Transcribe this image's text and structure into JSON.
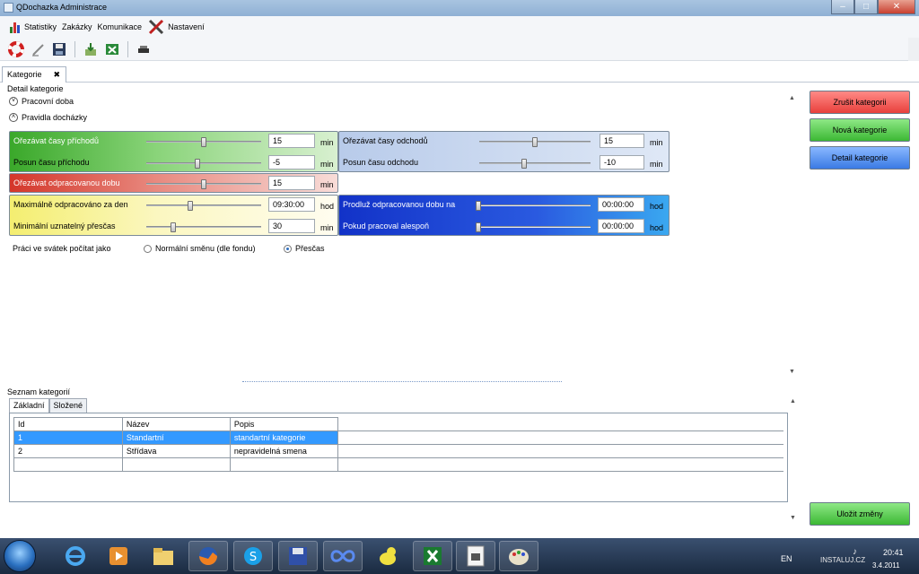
{
  "window": {
    "title": "QDochazka Administrace",
    "btn_min": "–",
    "btn_max": "□",
    "btn_close": "✕"
  },
  "menu": {
    "items": [
      {
        "label": "Statistiky",
        "icon": "bar-chart-icon"
      },
      {
        "label": "Zakázky"
      },
      {
        "label": "Komunikace"
      },
      {
        "label": "Nastavení",
        "icon": "tools-icon"
      }
    ]
  },
  "toolbar": {
    "icons": [
      "lifebuoy-icon",
      "edit-icon",
      "save-icon",
      "import-icon",
      "excel-export-icon",
      "print-icon"
    ]
  },
  "doc_tab": {
    "label": "Kategorie",
    "close": "✖"
  },
  "detail": {
    "group_title": "Detail kategorie",
    "expanders": [
      {
        "label": "Pracovní doba",
        "glyph": "˅"
      },
      {
        "label": "Pravidla docházky",
        "glyph": "˄"
      }
    ],
    "green_panel": {
      "row1": {
        "label": "Ořezávat časy příchodů",
        "value": "15",
        "unit": "min",
        "slider": 0.5
      },
      "row2": {
        "label": "Posun času příchodu",
        "value": "-5",
        "unit": "min",
        "slider": 0.45
      }
    },
    "blue_light_panel": {
      "row1": {
        "label": "Ořezávat časy odchodů",
        "value": "15",
        "unit": "min",
        "slider": 0.5
      },
      "row2": {
        "label": "Posun času odchodu",
        "value": "-10",
        "unit": "min",
        "slider": 0.4
      }
    },
    "red_panel": {
      "label": "Ořezávat odpracovanou dobu",
      "value": "15",
      "unit": "min",
      "slider": 0.5
    },
    "yellow_panel": {
      "row1": {
        "label": "Maximálně odpracováno za den",
        "value": "09:30:00",
        "unit": "hod",
        "slider": 0.38
      },
      "row2": {
        "label": "Minimální uznatelný přesčas",
        "value": "30",
        "unit": "min",
        "slider": 0.22
      }
    },
    "blue_dark_panel": {
      "row1": {
        "label": "Prodluž odpracovanou dobu na",
        "value": "00:00:00",
        "unit": "hod",
        "slider": 0.0
      },
      "row2": {
        "label": "Pokud pracoval alespoň",
        "value": "00:00:00",
        "unit": "hod",
        "slider": 0.0
      }
    },
    "holiday": {
      "label": "Práci ve svátek počítat jako",
      "option1": "Normální směnu (dle fondu)",
      "option2": "Přesčas",
      "selected": "option2"
    }
  },
  "actions": {
    "cancel": "Zrušit kategorii",
    "new": "Nová kategorie",
    "detail": "Detail kategorie",
    "save": "Uložit změny"
  },
  "list": {
    "group_title": "Seznam kategorií",
    "tabs": [
      "Základní",
      "Složené"
    ],
    "columns": [
      "Id",
      "Název",
      "Popis"
    ],
    "rows": [
      [
        "1",
        "Standartní",
        "standartní kategorie"
      ],
      [
        "2",
        "Střídava",
        "nepravidelná smena"
      ]
    ]
  },
  "taskbar": {
    "apps": [
      "ie-icon",
      "media-player-icon",
      "explorer-icon",
      "firefox-icon",
      "skype-icon",
      "floppy-icon",
      "infinity-icon",
      "duck-icon",
      "excel-icon",
      "document-icon",
      "paint-icon"
    ],
    "lang": "EN",
    "time": "20:41",
    "date": "3.4.2011",
    "watermark": "INSTALUJ.CZ"
  },
  "colors": {
    "green": "#46b834",
    "red": "#d9473a",
    "yellow": "#f6f296",
    "blue_light": "#c9d9f0",
    "blue_dark": "#1c3fd0",
    "btn_red": "#ee4c48",
    "btn_green": "#3fbf3a",
    "btn_blue": "#3f82e8"
  }
}
